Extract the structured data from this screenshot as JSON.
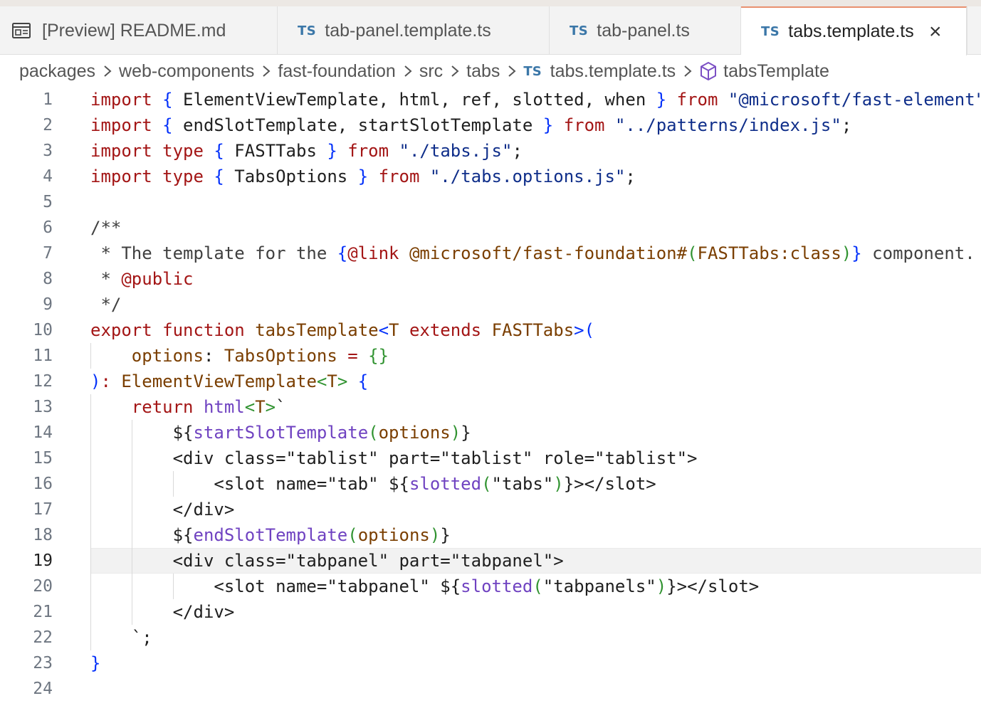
{
  "tabs": [
    {
      "label": "[Preview] README.md",
      "icon": "preview-icon",
      "active": false
    },
    {
      "label": "tab-panel.template.ts",
      "badge": "TS",
      "active": false
    },
    {
      "label": "tab-panel.ts",
      "badge": "TS",
      "active": false
    },
    {
      "label": "tabs.template.ts",
      "badge": "TS",
      "active": true,
      "close": "×"
    }
  ],
  "breadcrumb": {
    "items": [
      "packages",
      "web-components",
      "fast-foundation",
      "src",
      "tabs"
    ],
    "file_badge": "TS",
    "file": "tabs.template.ts",
    "symbol": "tabsTemplate"
  },
  "editor": {
    "current_line": 19,
    "line_numbers": [
      "1",
      "2",
      "3",
      "4",
      "5",
      "6",
      "7",
      "8",
      "9",
      "10",
      "11",
      "12",
      "13",
      "14",
      "15",
      "16",
      "17",
      "18",
      "19",
      "20",
      "21",
      "22",
      "23",
      "24"
    ],
    "lines": [
      [
        [
          "kw",
          "import"
        ],
        [
          "plain",
          " "
        ],
        [
          "br1",
          "{"
        ],
        [
          "plain",
          " ElementViewTemplate, html, ref, slotted, when "
        ],
        [
          "br1",
          "}"
        ],
        [
          "plain",
          " "
        ],
        [
          "kw",
          "from"
        ],
        [
          "plain",
          " "
        ],
        [
          "str",
          "\"@microsoft/fast-element\""
        ]
      ],
      [
        [
          "kw",
          "import"
        ],
        [
          "plain",
          " "
        ],
        [
          "br1",
          "{"
        ],
        [
          "plain",
          " endSlotTemplate, startSlotTemplate "
        ],
        [
          "br1",
          "}"
        ],
        [
          "plain",
          " "
        ],
        [
          "kw",
          "from"
        ],
        [
          "plain",
          " "
        ],
        [
          "str",
          "\"../patterns/index.js\""
        ],
        [
          "plain",
          ";"
        ]
      ],
      [
        [
          "kw",
          "import"
        ],
        [
          "plain",
          " "
        ],
        [
          "kw",
          "type"
        ],
        [
          "plain",
          " "
        ],
        [
          "br1",
          "{"
        ],
        [
          "plain",
          " FASTTabs "
        ],
        [
          "br1",
          "}"
        ],
        [
          "plain",
          " "
        ],
        [
          "kw",
          "from"
        ],
        [
          "plain",
          " "
        ],
        [
          "str",
          "\"./tabs.js\""
        ],
        [
          "plain",
          ";"
        ]
      ],
      [
        [
          "kw",
          "import"
        ],
        [
          "plain",
          " "
        ],
        [
          "kw",
          "type"
        ],
        [
          "plain",
          " "
        ],
        [
          "br1",
          "{"
        ],
        [
          "plain",
          " TabsOptions "
        ],
        [
          "br1",
          "}"
        ],
        [
          "plain",
          " "
        ],
        [
          "kw",
          "from"
        ],
        [
          "plain",
          " "
        ],
        [
          "str",
          "\"./tabs.options.js\""
        ],
        [
          "plain",
          ";"
        ]
      ],
      [],
      [
        [
          "cm",
          "/**"
        ]
      ],
      [
        [
          "cm",
          " * The template for the "
        ],
        [
          "br1",
          "{"
        ],
        [
          "kw",
          "@link"
        ],
        [
          "plain",
          " "
        ],
        [
          "ty",
          "@microsoft/fast-foundation#"
        ],
        [
          "br2",
          "("
        ],
        [
          "ty",
          "FASTTabs:class"
        ],
        [
          "br2",
          ")"
        ],
        [
          "br1",
          "}"
        ],
        [
          "cm",
          " component."
        ]
      ],
      [
        [
          "cm",
          " * "
        ],
        [
          "kw",
          "@public"
        ]
      ],
      [
        [
          "cm",
          " */"
        ]
      ],
      [
        [
          "kw",
          "export"
        ],
        [
          "plain",
          " "
        ],
        [
          "kw",
          "function"
        ],
        [
          "plain",
          " "
        ],
        [
          "ty",
          "tabsTemplate"
        ],
        [
          "br1",
          "<"
        ],
        [
          "ty",
          "T"
        ],
        [
          "plain",
          " "
        ],
        [
          "kw",
          "extends"
        ],
        [
          "plain",
          " "
        ],
        [
          "ty",
          "FASTTabs"
        ],
        [
          "br1",
          ">"
        ],
        [
          "br1",
          "("
        ]
      ],
      [
        [
          "plain",
          "    "
        ],
        [
          "ty",
          "options"
        ],
        [
          "plain",
          ": "
        ],
        [
          "ty",
          "TabsOptions"
        ],
        [
          "plain",
          " "
        ],
        [
          "kw",
          "="
        ],
        [
          "plain",
          " "
        ],
        [
          "br2",
          "{}"
        ]
      ],
      [
        [
          "br1",
          ")"
        ],
        [
          "kw",
          ":"
        ],
        [
          "plain",
          " "
        ],
        [
          "ty",
          "ElementViewTemplate"
        ],
        [
          "br2",
          "<"
        ],
        [
          "ty",
          "T"
        ],
        [
          "br2",
          ">"
        ],
        [
          "plain",
          " "
        ],
        [
          "br1",
          "{"
        ]
      ],
      [
        [
          "plain",
          "    "
        ],
        [
          "kw",
          "return"
        ],
        [
          "plain",
          " "
        ],
        [
          "fn2",
          "html"
        ],
        [
          "br2",
          "<"
        ],
        [
          "ty",
          "T"
        ],
        [
          "br2",
          ">"
        ],
        [
          "plain",
          "`"
        ]
      ],
      [
        [
          "plain",
          "        ${"
        ],
        [
          "fn2",
          "startSlotTemplate"
        ],
        [
          "br2",
          "("
        ],
        [
          "ty",
          "options"
        ],
        [
          "br2",
          ")"
        ],
        [
          "plain",
          "}"
        ]
      ],
      [
        [
          "plain",
          "        <div class=\"tablist\" part=\"tablist\" role=\"tablist\">"
        ]
      ],
      [
        [
          "plain",
          "            <slot name=\"tab\" ${"
        ],
        [
          "fn2",
          "slotted"
        ],
        [
          "br2",
          "("
        ],
        [
          "plain",
          "\"tabs\""
        ],
        [
          "br2",
          ")"
        ],
        [
          "plain",
          "}></slot>"
        ]
      ],
      [
        [
          "plain",
          "        </div>"
        ]
      ],
      [
        [
          "plain",
          "        ${"
        ],
        [
          "fn2",
          "endSlotTemplate"
        ],
        [
          "br2",
          "("
        ],
        [
          "ty",
          "options"
        ],
        [
          "br2",
          ")"
        ],
        [
          "plain",
          "}"
        ]
      ],
      [
        [
          "plain",
          "        <div class=\"tabpanel\" part=\"tabpanel\">"
        ]
      ],
      [
        [
          "plain",
          "            <slot name=\"tabpanel\" ${"
        ],
        [
          "fn2",
          "slotted"
        ],
        [
          "br2",
          "("
        ],
        [
          "plain",
          "\"tabpanels\""
        ],
        [
          "br2",
          ")"
        ],
        [
          "plain",
          "}></slot>"
        ]
      ],
      [
        [
          "plain",
          "        </div>"
        ]
      ],
      [
        [
          "plain",
          "    `;"
        ]
      ],
      [
        [
          "br1",
          "}"
        ]
      ],
      []
    ]
  },
  "colors": {
    "active_tab_border": "#e8916f",
    "ts_badge": "#3b77a8",
    "keyword": "#a31515",
    "bracket": "#0431fa",
    "function_call": "#6f42c1"
  }
}
